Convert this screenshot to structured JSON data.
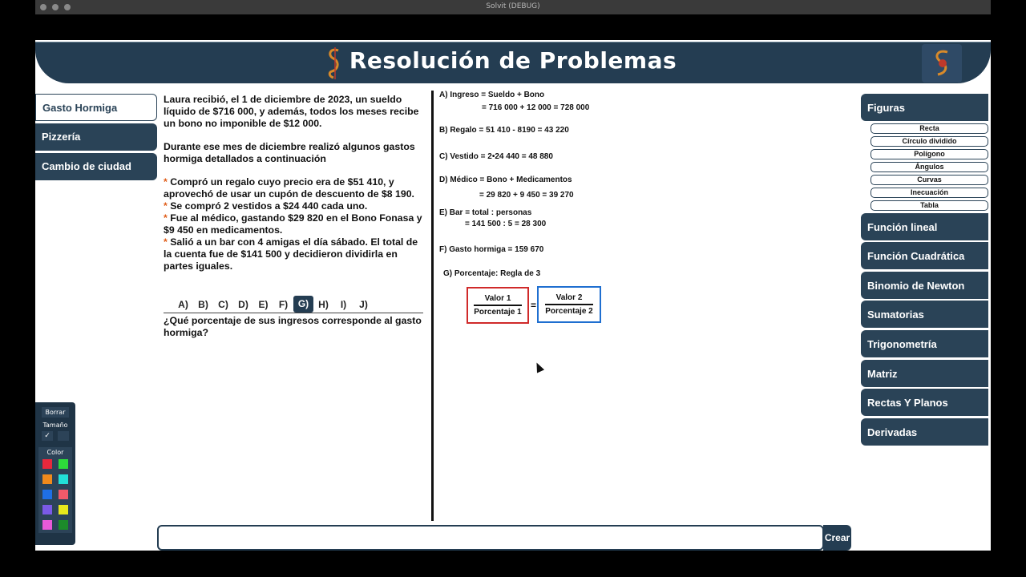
{
  "window": {
    "title": "Solvit (DEBUG)"
  },
  "header": {
    "title": "Resolución de Problemas"
  },
  "left_nav": {
    "items": [
      {
        "label": "Gasto Hormiga",
        "active": true
      },
      {
        "label": "Pizzería",
        "active": false
      },
      {
        "label": "Cambio de ciudad",
        "active": false
      }
    ]
  },
  "problem": {
    "intro": "Laura recibió, el 1 de diciembre de 2023, un sueldo líquido de $716 000, y además, todos los meses recibe un bono no imponible de $12 000.",
    "context": "Durante ese mes de diciembre realizó algunos gastos hormiga detallados a continuación",
    "bullets": [
      "Compró un regalo cuyo precio era de $51 410, y aprovechó de usar un cupón de descuento de $8 190.",
      "Se compró 2 vestidos a $24 440 cada uno.",
      "Fue al médico, gastando $29 820 en el Bono Fonasa y $9 450 en medicamentos.",
      "Salió a un bar con 4 amigas el día sábado. El total de la cuenta fue de $141 500 y decidieron dividirla en partes iguales."
    ],
    "star": "*"
  },
  "question_tabs": {
    "items": [
      "A)",
      "B)",
      "C)",
      "D)",
      "E)",
      "F)",
      "G)",
      "H)",
      "I)",
      "J)"
    ],
    "selected": "G)"
  },
  "question": {
    "text": "¿Qué porcentaje de sus ingresos corresponde al gasto hormiga?"
  },
  "solution": {
    "lines": {
      "a1": "A) Ingreso = Sueldo + Bono",
      "a2": "= 716 000 + 12 000 = 728 000",
      "b1": "B) Regalo = 51 410 - 8190 = 43 220",
      "c1": "C) Vestido = 2•24 440 = 48 880",
      "d1": "D) Médico = Bono + Medicamentos",
      "d2": "= 29 820 + 9 450 = 39 270",
      "e1": "E) Bar = total : personas",
      "e2": "= 141 500 : 5 = 28 300",
      "f1": "F) Gasto hormiga = 159 670",
      "g1": "G) Porcentaje: Regla de 3"
    },
    "fraction_left": {
      "top": "Valor 1",
      "bottom": "Porcentaje 1",
      "color": "#d02a2a"
    },
    "fraction_right": {
      "top": "Valor 2",
      "bottom": "Porcentaje 2",
      "color": "#1f6fd0"
    },
    "equals": "="
  },
  "right_nav": {
    "figuras": "Figuras",
    "sub_items": [
      "Recta",
      "Círculo dividido",
      "Polígono",
      "Ángulos",
      "Curvas",
      "Inecuación",
      "Tabla"
    ],
    "items": [
      "Función lineal",
      "Función Cuadrática",
      "Binomio de Newton",
      "Sumatorias",
      "Trigonometría",
      "Matriz",
      "Rectas Y Planos",
      "Derivadas"
    ]
  },
  "palette": {
    "erase_label": "Borrar",
    "size_label": "Tamaño",
    "size_checked": "✓",
    "color_label": "Color",
    "colors": [
      "#e8283c",
      "#2ddc3a",
      "#f08a1c",
      "#22e0d8",
      "#1f6fe6",
      "#f05a6a",
      "#7a5ae6",
      "#e8e81c",
      "#e85ad8",
      "#1c8a2a"
    ]
  },
  "input": {
    "value": "",
    "create_label": "Crear"
  },
  "colors": {
    "brand": "#243d52",
    "accent": "#e05e1a"
  }
}
